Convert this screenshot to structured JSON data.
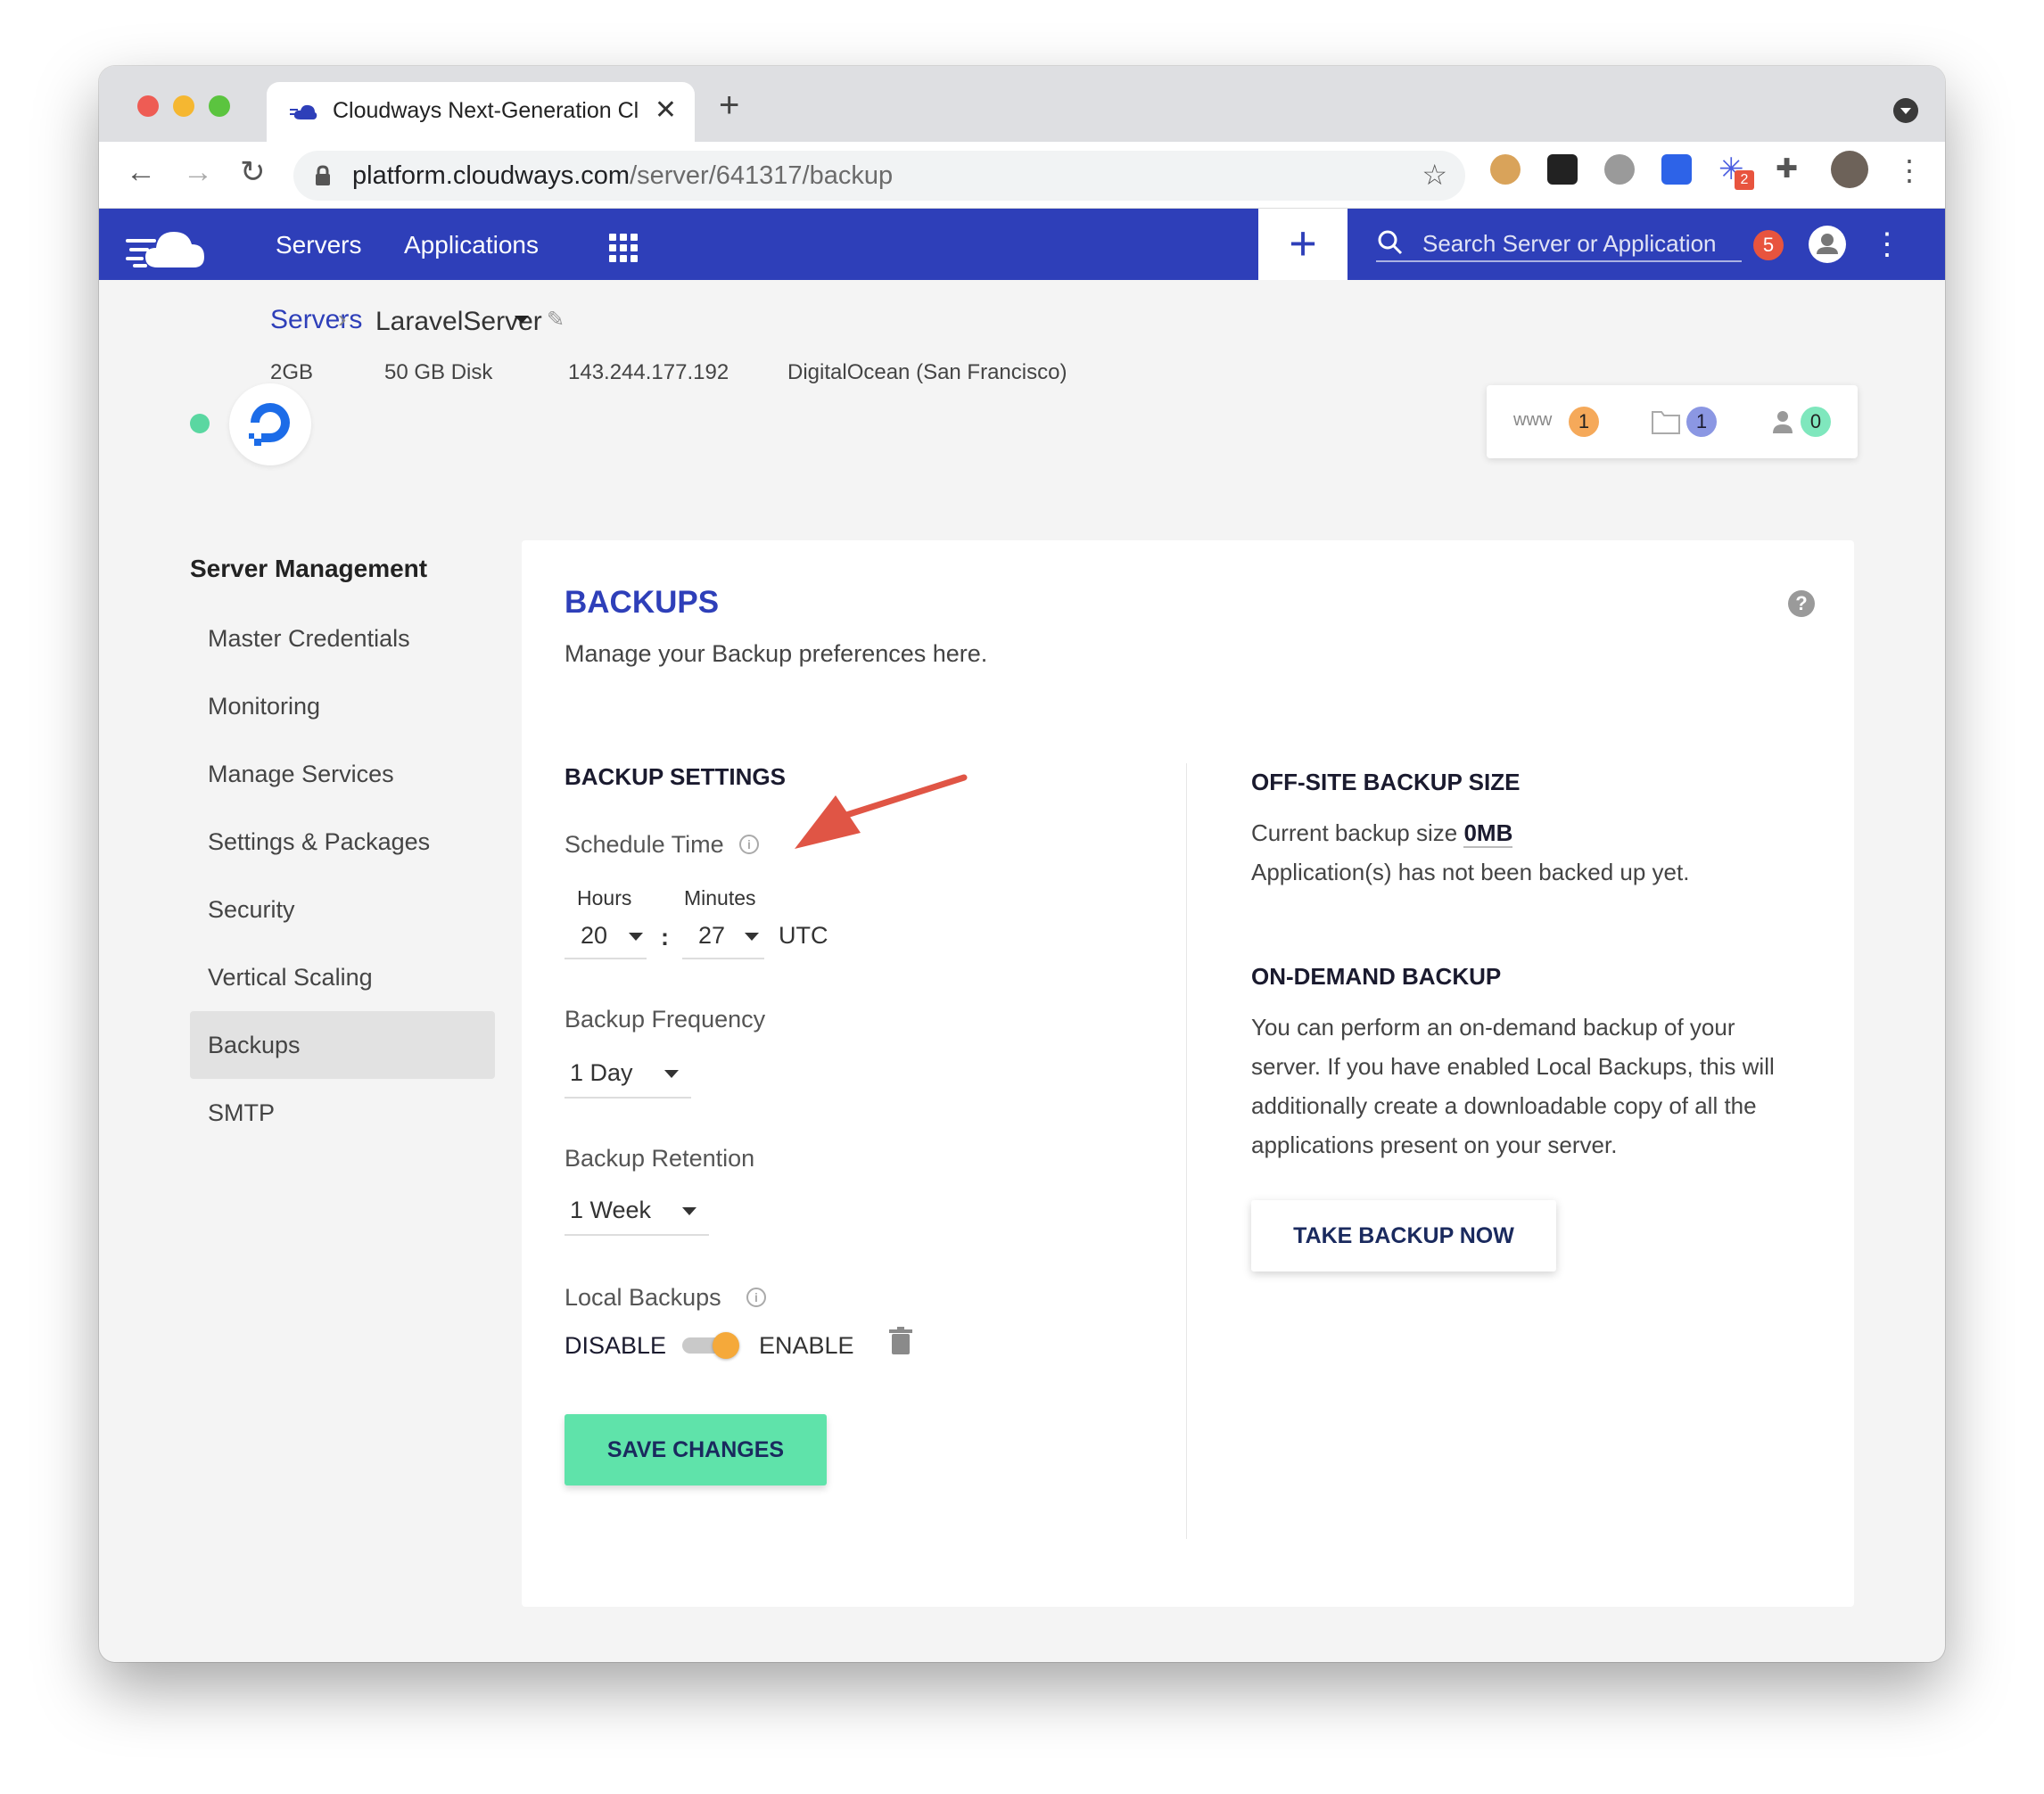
{
  "browser": {
    "tab_title": "Cloudways Next-Generation Cl",
    "url_host": "platform.cloudways.com",
    "url_path": "/server/641317/backup",
    "extension_badge": "2"
  },
  "appbar": {
    "nav": [
      "Servers",
      "Applications"
    ],
    "search_placeholder": "Search Server or Application",
    "notifications": "5"
  },
  "server": {
    "crumb_root": "Servers",
    "name": "LaravelServer",
    "size": "2GB",
    "disk": "50 GB Disk",
    "ip": "143.244.177.192",
    "provider": "DigitalOcean (San Francisco)",
    "stats": {
      "www_label": "www",
      "apps": "1",
      "folders": "1",
      "users": "0"
    }
  },
  "sidebar": {
    "title": "Server Management",
    "items": [
      "Master Credentials",
      "Monitoring",
      "Manage Services",
      "Settings & Packages",
      "Security",
      "Vertical Scaling",
      "Backups",
      "SMTP"
    ],
    "active": "Backups"
  },
  "backups": {
    "title": "BACKUPS",
    "subtitle": "Manage your Backup preferences here.",
    "settings_title": "BACKUP SETTINGS",
    "schedule_label": "Schedule Time",
    "hours_label": "Hours",
    "minutes_label": "Minutes",
    "hours_value": "20",
    "minutes_value": "27",
    "separator": ":",
    "timezone": "UTC",
    "frequency_label": "Backup Frequency",
    "frequency_value": "1 Day",
    "retention_label": "Backup Retention",
    "retention_value": "1 Week",
    "local_label": "Local Backups",
    "disable_label": "DISABLE",
    "enable_label": "ENABLE",
    "local_enabled": true,
    "save_label": "SAVE CHANGES",
    "offsite_title": "OFF-SITE BACKUP SIZE",
    "current_size_prefix": "Current backup size",
    "current_size_value": "0MB",
    "not_backed_up": "Application(s) has not been backed up yet.",
    "ondemand_title": "ON-DEMAND BACKUP",
    "ondemand_line1": "You can perform an on-demand backup of your",
    "ondemand_line2": "server. If you have enabled Local Backups, this will",
    "ondemand_line3": "additionally create a downloadable copy of all the",
    "ondemand_line4": "applications present on your server.",
    "take_backup_label": "TAKE BACKUP NOW"
  },
  "colors": {
    "brand": "#2e3fb9",
    "save": "#5fe3aa",
    "toggle": "#f5a93a",
    "arrow": "#e05545"
  }
}
